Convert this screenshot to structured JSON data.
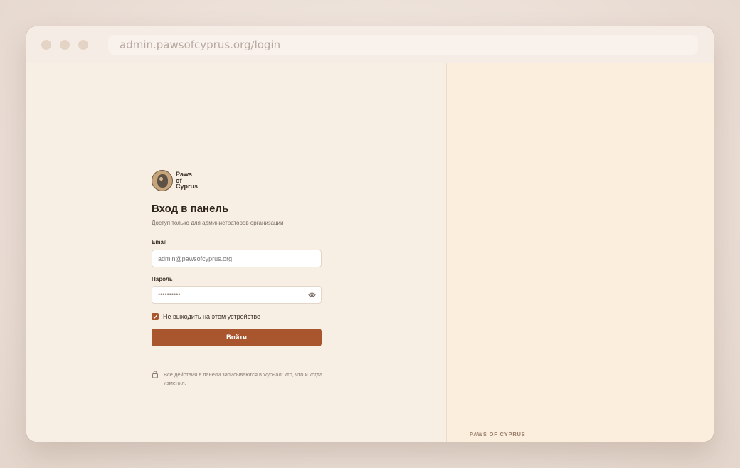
{
  "browser": {
    "url": "admin.pawsofcyprus.org/login"
  },
  "brand": {
    "logo_lines": [
      "Paws",
      "of",
      "Cyprus"
    ],
    "footer": "PAWS OF CYPRUS"
  },
  "login": {
    "title": "Вход в панель",
    "subtitle": "Доступ только для администраторов организации",
    "email_label": "Email",
    "email_placeholder": "admin@pawsofcyprus.org",
    "password_label": "Пароль",
    "password_value": "••••••••••",
    "remember_label": "Не выходить на этом устройстве",
    "remember_checked": true,
    "submit_label": "Войти",
    "audit_note": "Все действия в панели записываются в журнал: кто, что и когда изменил."
  },
  "colors": {
    "accent": "#a9562e",
    "page_bg": "#f7efe4",
    "panel_bg": "#fbeedd"
  }
}
